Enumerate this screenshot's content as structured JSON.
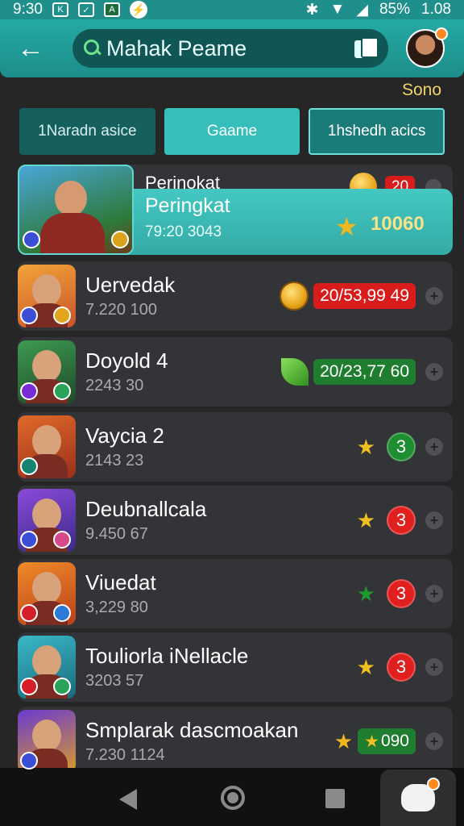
{
  "status": {
    "time": "9:30",
    "battery": "85%",
    "clock": "1.08",
    "icons": [
      "calendar-icon",
      "check-icon",
      "android-icon",
      "bolt-icon",
      "bluetooth-icon",
      "wifi-icon",
      "signal-icon"
    ]
  },
  "header": {
    "search_text": "Mahak Peame",
    "back_icon": "arrow-left-icon",
    "corner_label": "Sono"
  },
  "tabs": [
    {
      "label": "1Naradn asice"
    },
    {
      "label": "Gaame"
    },
    {
      "label": "1hshedh acics"
    }
  ],
  "featured": {
    "back_title": "Perinokat",
    "back_pill": "20",
    "name": "Peringkat",
    "sub": "79:20 3043",
    "score": "10060"
  },
  "rows": [
    {
      "name": "Uervedak",
      "sub": "7.220 100",
      "icon": "coin-icon",
      "value": "20/53,99 49",
      "value_style": "red"
    },
    {
      "name": "Doyold 4",
      "sub": "2243 30",
      "icon": "leaf-icon",
      "value": "20/23,77 60",
      "value_style": "green"
    },
    {
      "name": "Vaycia 2",
      "sub": "2143 23",
      "icon": "star-icon",
      "value": "3",
      "value_style": "green"
    },
    {
      "name": "Deubnallcala",
      "sub": "9.450 67",
      "icon": "star-icon",
      "value": "3",
      "value_style": "red"
    },
    {
      "name": "Viuedat",
      "sub": "3,229 80",
      "icon": "green-star-icon",
      "value": "3",
      "value_style": "red"
    },
    {
      "name": "Touliorla iNellacle",
      "sub": "3203 57",
      "icon": "star-icon",
      "value": "3",
      "value_style": "red"
    },
    {
      "name": "Smplarak dascmoakan",
      "sub": "7.230 1124",
      "icon": "star-icon",
      "value": "090",
      "value_style": "green"
    }
  ],
  "colors": {
    "teal": "#25a9a4",
    "featured": "#44c8c2",
    "red": "#d81c1c",
    "green": "#1e7d2e",
    "gold": "#f0b820"
  }
}
